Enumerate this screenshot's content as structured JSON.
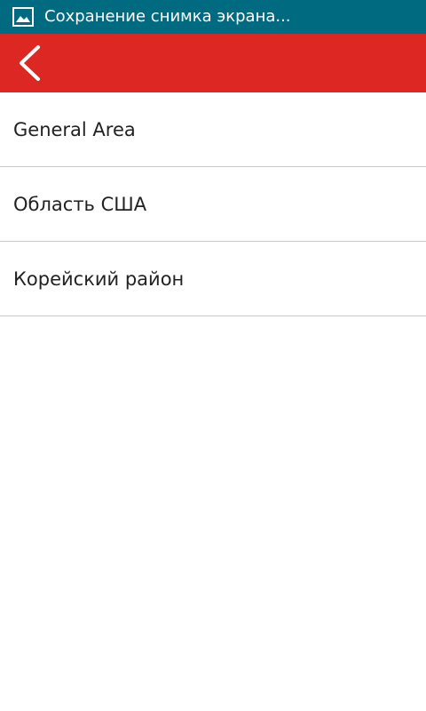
{
  "colors": {
    "status_bar_bg": "#006a80",
    "app_bar_bg": "#dc2722",
    "back_icon": "#ffffff",
    "divider": "#c8c8c8"
  },
  "status_bar": {
    "icon": "screenshot-image-icon",
    "notification_text": "Сохранение снимка экрана..."
  },
  "app_bar": {
    "back_icon": "chevron-left-icon"
  },
  "list": {
    "items": [
      {
        "label": "General Area"
      },
      {
        "label": "Область США"
      },
      {
        "label": "Корейский район"
      }
    ]
  }
}
